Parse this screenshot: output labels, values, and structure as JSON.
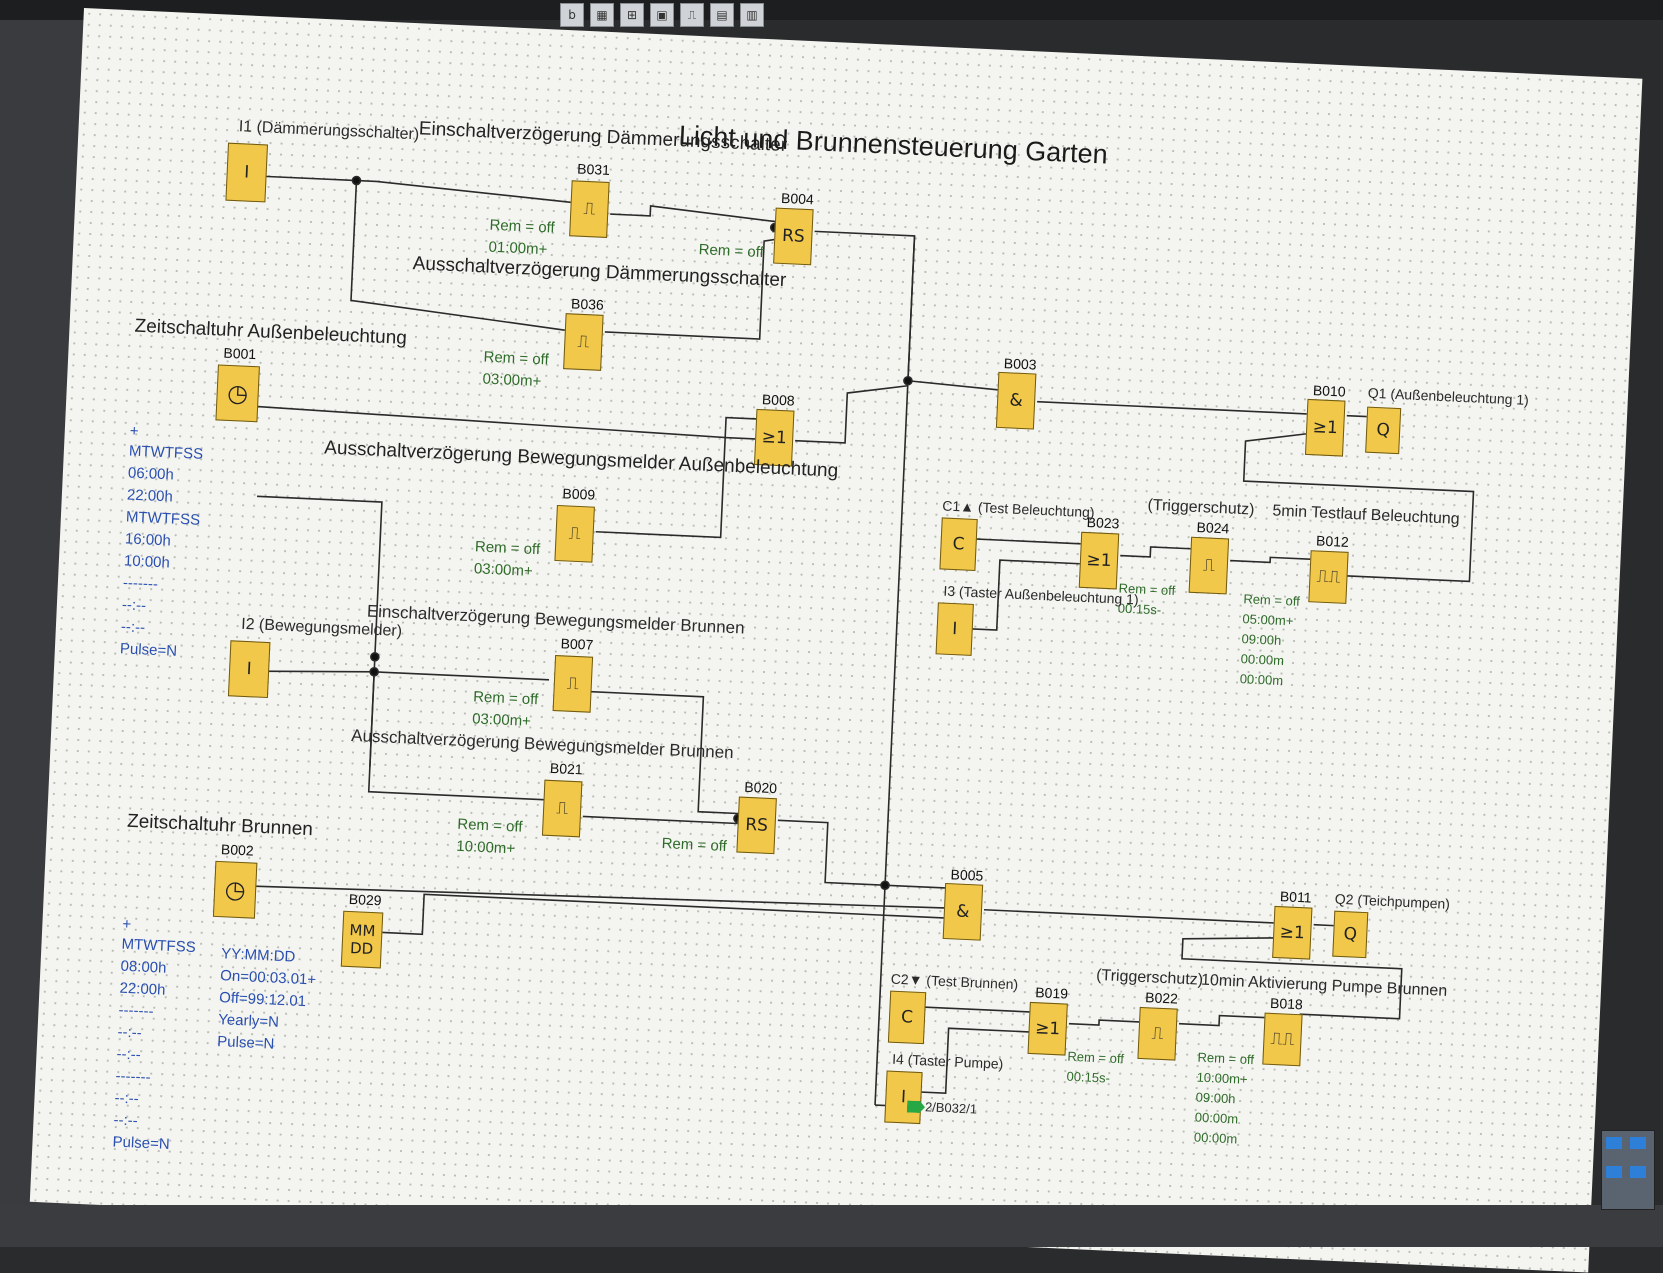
{
  "toolbar": {
    "icons": [
      "b-icon",
      "cb-icon",
      "dim-icon",
      "camera-icon",
      "step-icon",
      "grid-icon",
      "grid2-icon"
    ]
  },
  "title": "Licht und Brunnensteuerung Garten",
  "labels": {
    "i1": "I1 (Dämmerungsschalter)",
    "einschalt_daemm": "Einschaltverzögerung Dämmerungsschalter",
    "ausschalt_daemm": "Ausschaltverzögerung Dämmerungsschalter",
    "zeit_aussen": "Zeitschaltuhr Außenbeleuchtung",
    "ausschalt_bew_aussen": "Ausschaltverzögerung Bewegungsmelder Außenbeleuchtung",
    "i2": "I2 (Bewegungsmelder)",
    "einschalt_bew_brunnen": "Einschaltverzögerung Bewegungsmelder Brunnen",
    "ausschalt_bew_brunnen": "Ausschaltverzögerung Bewegungsmelder Brunnen",
    "zeit_brunnen": "Zeitschaltuhr Brunnen",
    "c1": "C1▲ (Test Beleuchtung)",
    "i3": "I3 (Taster Außenbeleuchtung 1)",
    "trigger1": "(Triggerschutz)",
    "testlauf": "5min Testlauf Beleuchtung",
    "q1": "Q1 (Außenbeleuchtung 1)",
    "q2": "Q2 (Teichpumpen)",
    "c2": "C2▼ (Test Brunnen)",
    "i4": "I4 (Taster Pumpe)",
    "trigger2": "(Triggerschutz)",
    "aktiv_pumpe": "10min Aktivierung Pumpe Brunnen",
    "connector": "2/B032/1"
  },
  "blocks": {
    "B031": {
      "id": "B031",
      "sym": "⎍",
      "rem": "Rem = off",
      "time": "01:00m+"
    },
    "B004": {
      "id": "B004",
      "sym": "RS",
      "rem": "Rem = off"
    },
    "B036": {
      "id": "B036",
      "sym": "⎍",
      "rem": "Rem = off",
      "time": "03:00m+"
    },
    "B001": {
      "id": "B001",
      "sym": "◷"
    },
    "B008": {
      "id": "B008",
      "sym": "≥1"
    },
    "B009": {
      "id": "B009",
      "sym": "⎍",
      "rem": "Rem = off",
      "time": "03:00m+"
    },
    "B007": {
      "id": "B007",
      "sym": "⎍",
      "rem": "Rem = off",
      "time": "03:00m+"
    },
    "B021": {
      "id": "B021",
      "sym": "⎍",
      "rem": "Rem = off",
      "time": "10:00m+"
    },
    "B020": {
      "id": "B020",
      "sym": "RS",
      "rem": "Rem = off"
    },
    "B002": {
      "id": "B002",
      "sym": "◷"
    },
    "B029": {
      "id": "B029",
      "sym": "MM DD"
    },
    "B003": {
      "id": "B003",
      "sym": "&"
    },
    "B010": {
      "id": "B010",
      "sym": "≥1"
    },
    "Q1": {
      "id": "Q1",
      "sym": "Q"
    },
    "C1": {
      "id": "C1",
      "sym": "C"
    },
    "B023": {
      "id": "B023",
      "sym": "≥1",
      "rem": "Rem = off",
      "time": "00:15s-"
    },
    "B024": {
      "id": "B024",
      "sym": "⎍"
    },
    "B012": {
      "id": "B012",
      "sym": "⎍⎍",
      "rem": "Rem = off",
      "t1": "05:00m+",
      "t2": "09:00h",
      "t3": "00:00m",
      "t4": "00:00m"
    },
    "I3": {
      "id": "I3",
      "sym": "I"
    },
    "B005": {
      "id": "B005",
      "sym": "&"
    },
    "B011": {
      "id": "B011",
      "sym": "≥1"
    },
    "Q2": {
      "id": "Q2",
      "sym": "Q"
    },
    "C2": {
      "id": "C2",
      "sym": "C"
    },
    "B019": {
      "id": "B019",
      "sym": "≥1",
      "rem": "Rem = off",
      "time": "00:15s-"
    },
    "B022": {
      "id": "B022",
      "sym": "⎍"
    },
    "B018": {
      "id": "B018",
      "sym": "⎍⎍",
      "rem": "Rem = off",
      "t1": "10:00m+",
      "t2": "09:00h",
      "t3": "00:00m",
      "t4": "00:00m"
    },
    "I1": {
      "id": "I1",
      "sym": "I"
    },
    "I2": {
      "id": "I2",
      "sym": "I"
    },
    "I4": {
      "id": "I4",
      "sym": "I"
    }
  },
  "timer1": {
    "plus": "+",
    "days1": "MTWTFSS",
    "on1": "06:00h",
    "off1": "22:00h",
    "days2": "MTWTFSS",
    "on2": "16:00h",
    "off2": "10:00h",
    "dash1": "-------",
    "dash2": "--:--",
    "dash3": "--:--",
    "pulse": "Pulse=N"
  },
  "timer2": {
    "plus": "+",
    "days1": "MTWTFSS",
    "on1": "08:00h",
    "off1": "22:00h",
    "dash1": "-------",
    "dash2": "--:--",
    "dash3": "--:--",
    "dash4": "-------",
    "dash5": "--:--",
    "dash6": "--:--",
    "pulse": "Pulse=N"
  },
  "b029_params": {
    "fmt": "YY:MM:DD",
    "on": "On=00:03.01+",
    "off": "Off=99:12.01",
    "yearly": "Yearly=N",
    "pulse": "Pulse=N"
  }
}
